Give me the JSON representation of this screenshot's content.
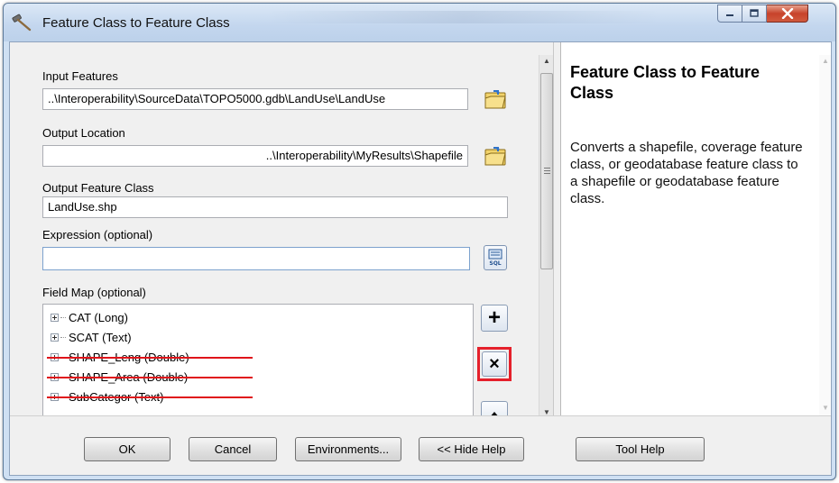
{
  "window": {
    "title": "Feature Class to Feature Class"
  },
  "form": {
    "input_features": {
      "label": "Input Features",
      "value": "..\\Interoperability\\SourceData\\TOPO5000.gdb\\LandUse\\LandUse"
    },
    "output_location": {
      "label": "Output Location",
      "value": "..\\Interoperability\\MyResults\\Shapefile"
    },
    "output_feature_class": {
      "label": "Output Feature Class",
      "value": "LandUse.shp"
    },
    "expression": {
      "label": "Expression (optional)",
      "value": ""
    },
    "field_map": {
      "label": "Field Map (optional)",
      "items": [
        {
          "text": "CAT (Long)",
          "removed": false
        },
        {
          "text": "SCAT (Text)",
          "removed": false
        },
        {
          "text": "SHAPE_Leng (Double)",
          "removed": true
        },
        {
          "text": "SHAPE_Area (Double)",
          "removed": true
        },
        {
          "text": "SubCategor (Text)",
          "removed": true
        }
      ]
    }
  },
  "side_buttons": {
    "add_glyph": "+",
    "remove_glyph": "×",
    "sql_label": "SQL"
  },
  "help": {
    "title": "Feature Class to Feature Class",
    "body": "Converts a shapefile, coverage feature class, or geodatabase feature class to a shapefile or geodatabase feature class."
  },
  "buttons": {
    "ok": "OK",
    "cancel": "Cancel",
    "environments": "Environments...",
    "hide_help": "<< Hide Help",
    "tool_help": "Tool Help"
  },
  "icons": {
    "app": "hammer-icon",
    "browse": "folder-open-icon",
    "sql": "sql-icon"
  },
  "colors": {
    "highlight": "#e5202b",
    "strike": "#e0141a",
    "close_button": "#c7432b"
  }
}
